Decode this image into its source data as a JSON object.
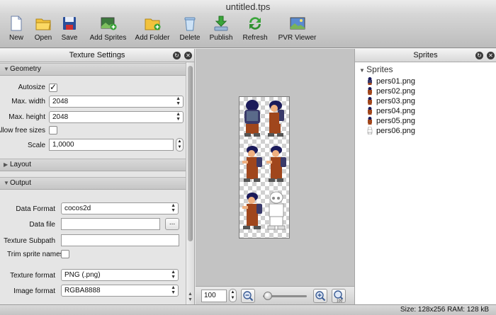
{
  "window": {
    "title": "untitled.tps"
  },
  "toolbar": [
    {
      "label": "New",
      "icon": "new-document-icon"
    },
    {
      "label": "Open",
      "icon": "folder-open-icon"
    },
    {
      "label": "Save",
      "icon": "floppy-save-icon"
    },
    {
      "label": "Add Sprites",
      "icon": "add-sprites-icon"
    },
    {
      "label": "Add Folder",
      "icon": "add-folder-icon"
    },
    {
      "label": "Delete",
      "icon": "trash-icon"
    },
    {
      "label": "Publish",
      "icon": "publish-icon"
    },
    {
      "label": "Refresh",
      "icon": "refresh-icon"
    },
    {
      "label": "PVR Viewer",
      "icon": "pvr-viewer-icon"
    }
  ],
  "texture_settings": {
    "title": "Texture Settings",
    "geometry": {
      "header": "Geometry",
      "autosize_label": "Autosize",
      "autosize_checked": true,
      "max_width_label": "Max. width",
      "max_width_value": "2048",
      "max_height_label": "Max. height",
      "max_height_value": "2048",
      "allow_free_sizes_label": "Allow free sizes",
      "allow_free_sizes_checked": false,
      "scale_label": "Scale",
      "scale_value": "1,0000"
    },
    "layout": {
      "header": "Layout"
    },
    "output": {
      "header": "Output",
      "data_format_label": "Data Format",
      "data_format_value": "cocos2d",
      "data_file_label": "Data file",
      "data_file_value": "",
      "browse_label": "...",
      "texture_subpath_label": "Texture Subpath",
      "texture_subpath_value": "",
      "trim_sprite_names_label": "Trim sprite names",
      "trim_sprite_names_checked": false,
      "texture_format_label": "Texture format",
      "texture_format_value": "PNG (.png)",
      "image_format_label": "Image format",
      "image_format_value": "RGBA8888"
    }
  },
  "canvas": {
    "zoom_value": "100",
    "zoom_out_icon": "zoom-out-icon",
    "zoom_fit_icon": "zoom-fit-icon",
    "zoom_in_icon": "zoom-in-icon",
    "zoom_100_label": "100",
    "zoom_level": 0.05
  },
  "sprites_panel": {
    "title": "Sprites",
    "group_label": "Sprites",
    "items": [
      "pers01.png",
      "pers02.png",
      "pers03.png",
      "pers04.png",
      "pers05.png",
      "pers06.png"
    ]
  },
  "status": {
    "text": "Size: 128x256 RAM: 128 kB"
  },
  "colors": {
    "canvas_bg": "#c3c3c3",
    "shirt": "#3a3a6a",
    "pants": "#a0461c",
    "hair": "#1a1a5a",
    "skin": "#f0b080"
  }
}
